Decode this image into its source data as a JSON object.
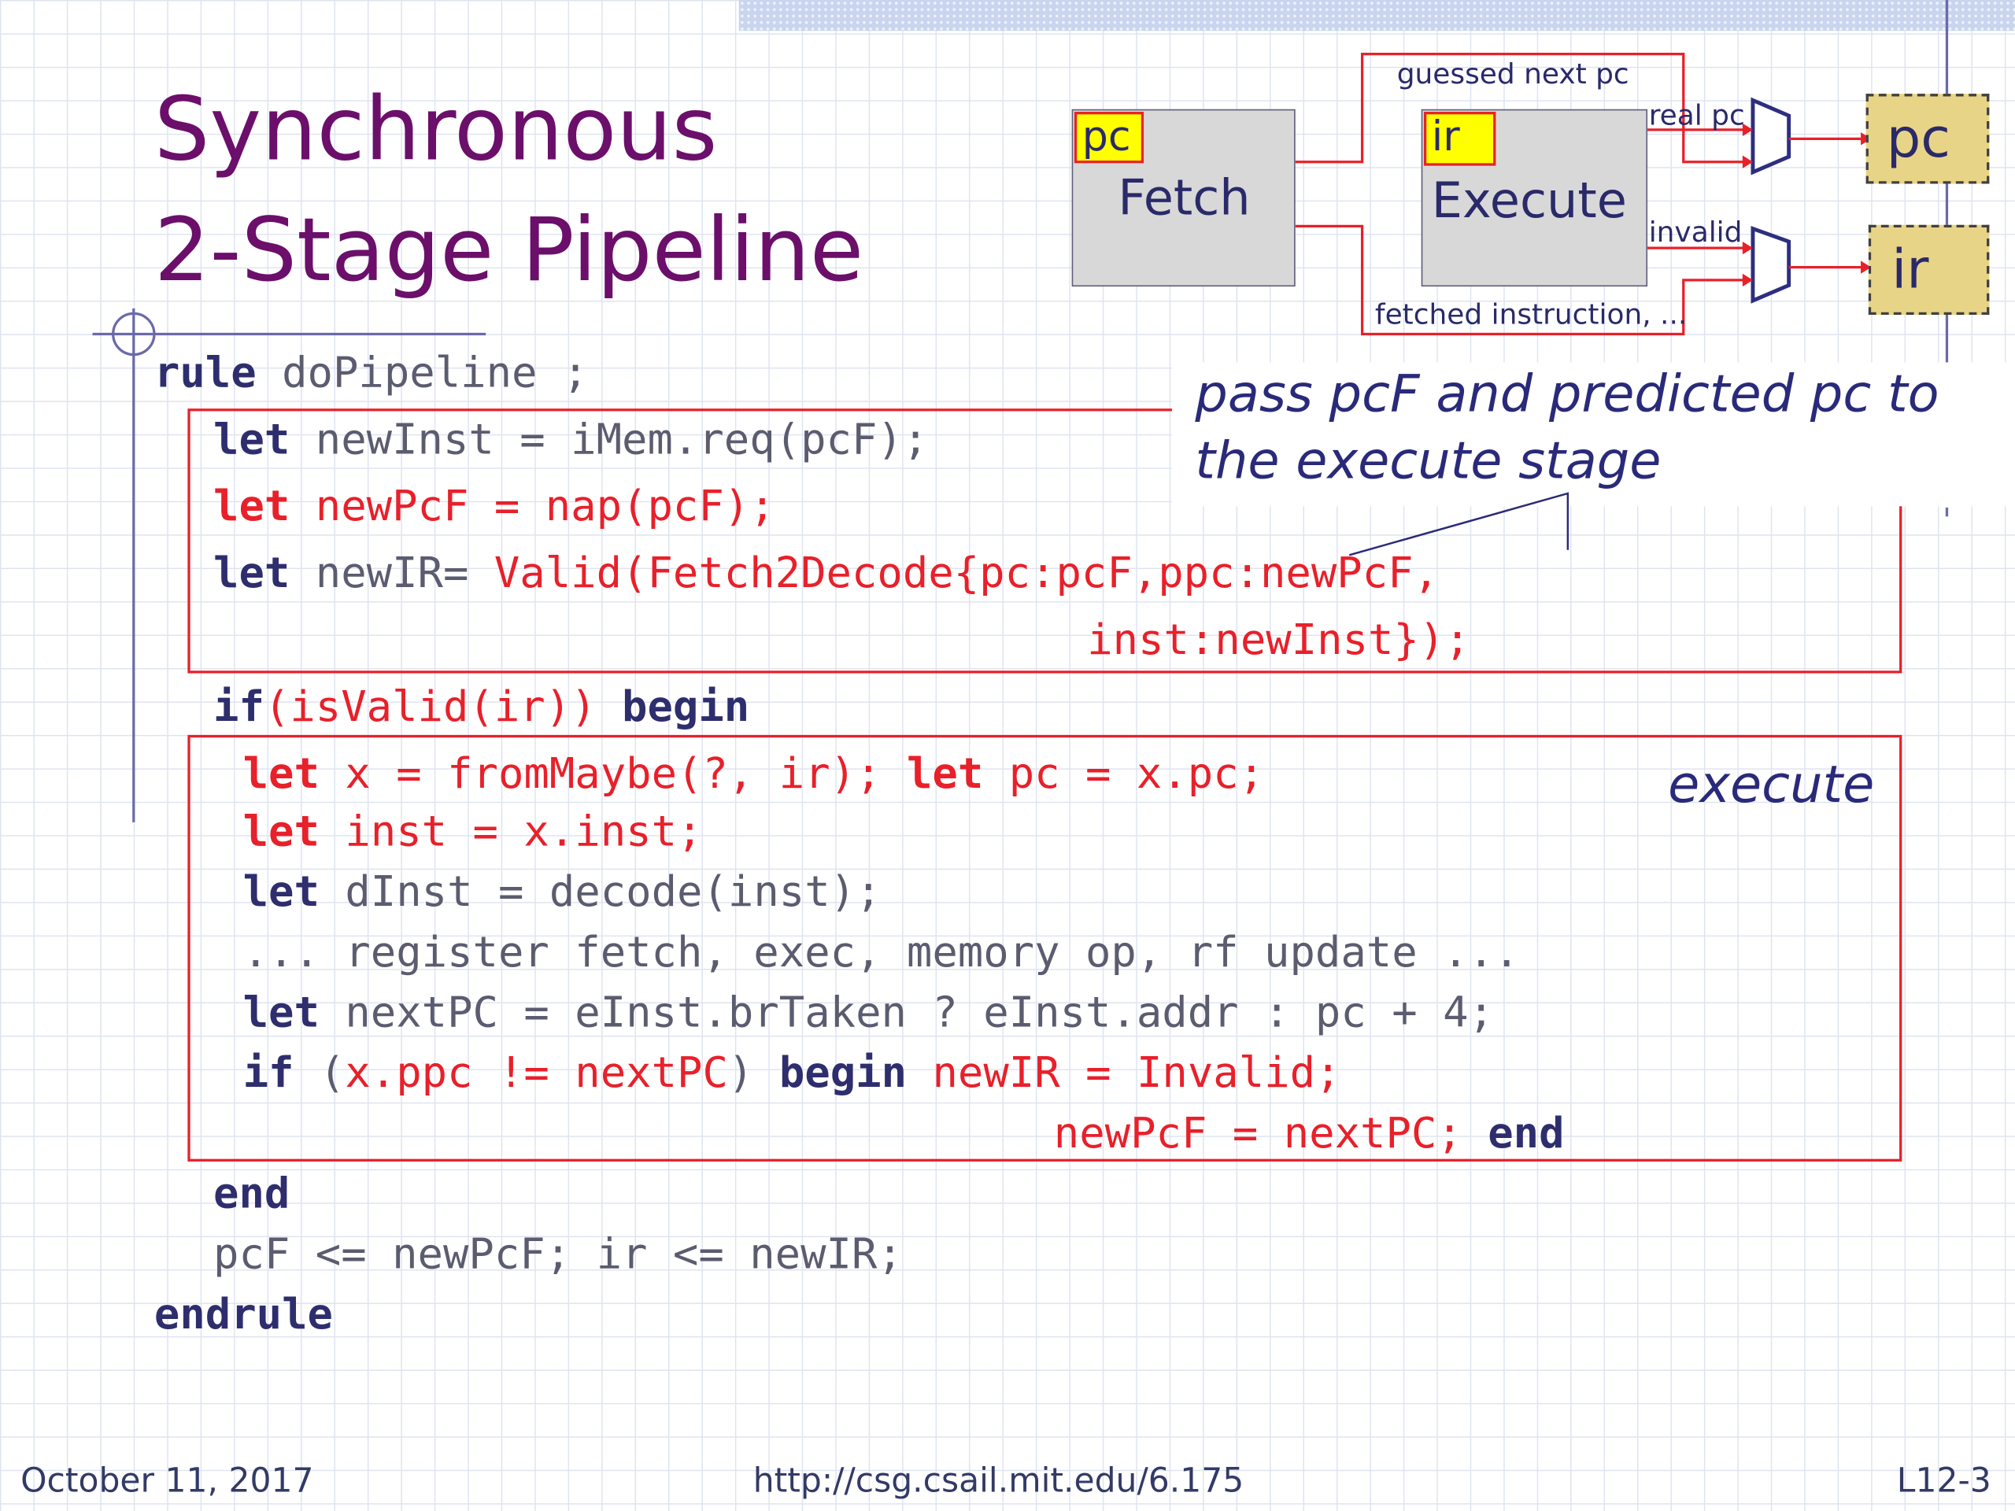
{
  "title": {
    "line1": "Synchronous",
    "line2": "2-Stage Pipeline"
  },
  "diagram": {
    "fetch_stage": {
      "label": "Fetch",
      "register": "pc"
    },
    "execute_stage": {
      "label": "Execute",
      "register": "ir"
    },
    "out_pc": "pc",
    "out_ir": "ir",
    "guessed_next_pc": "guessed next pc",
    "real_pc": "real pc",
    "invalid": "invalid",
    "fetched_instruction": "fetched instruction, ..."
  },
  "annotations": {
    "pass_line1": "pass pcF and predicted pc to",
    "pass_line2": "the execute stage",
    "execute": "execute"
  },
  "code": {
    "rule_kw": "rule",
    "rule_name": " doPipeline ;",
    "l1_kw": "let",
    "l1_rest": " newInst = iMem.req(pcF);",
    "l2_kw": "let",
    "l2_rest": " newPcF = nap(pcF);",
    "l3_kw": "let",
    "l3_mid": " newIR= ",
    "l3_red": "Valid(Fetch2Decode{pc:pcF,ppc:newPcF,",
    "l4": "inst:newInst});",
    "if1_kw": "if",
    "if1_cond": "(isValid(ir))",
    "if1_begin": "begin",
    "e1_kw1": "let",
    "e1_mid": " x = fromMaybe(?, ir);",
    "e1_kw2": "let",
    "e1_rest": " pc = x.pc;",
    "e2_kw": "let",
    "e2_rest": " inst = x.inst;",
    "e3_kw": "let",
    "e3_rest": " dInst = decode(inst);",
    "e4": "... register fetch, exec, memory op, rf update ...",
    "e5_kw": "let",
    "e5_rest": " nextPC = eInst.brTaken ? eInst.addr : pc + 4;",
    "e6_kw": "if",
    "e6_open": " (",
    "e6_red": "x.ppc != nextPC",
    "e6_close": ")",
    "e6_begin": "begin",
    "e6_assign": "newIR = Invalid;",
    "e7_assign": "newPcF = nextPC;",
    "e7_end": "end",
    "end_kw": "end",
    "assign_line": "pcF <= newPcF; ir <= newIR;",
    "endrule_kw": "endrule"
  },
  "footer": {
    "date": "October 11, 2017",
    "url": "http://csg.csail.mit.edu/6.175",
    "slide": "L12-3"
  }
}
